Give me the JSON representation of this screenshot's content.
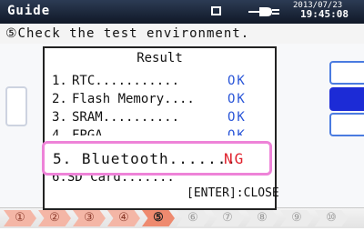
{
  "title_bar": {
    "title": "Guide",
    "date": "2013/07/23",
    "time": "19:45:08"
  },
  "instruction": "⑤Check the test environment.",
  "dialog": {
    "header": "Result",
    "rows": [
      {
        "num": "1.",
        "label": "RTC...........",
        "status": "OK"
      },
      {
        "num": "2.",
        "label": "Flash Memory....",
        "status": "OK"
      },
      {
        "num": "3.",
        "label": "SRAM..........",
        "status": "OK"
      },
      {
        "num": "4.",
        "label": "FPGA",
        "status": "OK"
      }
    ],
    "highlighted": {
      "num": "5.",
      "label": "Bluetooth.......",
      "status": "NG"
    },
    "cut_row": "6.SD Card.......",
    "close_label": "[ENTER]:CLOSE"
  },
  "steps": [
    "①",
    "②",
    "③",
    "④",
    "⑤",
    "⑥",
    "⑦",
    "⑧",
    "⑨",
    "⑩"
  ],
  "colors": {
    "ok": "#2a56d8",
    "ng": "#e0202b",
    "highlight_border": "#ee83d8",
    "current_step": "#ee8a6f",
    "done_step": "#f4b6a6"
  }
}
